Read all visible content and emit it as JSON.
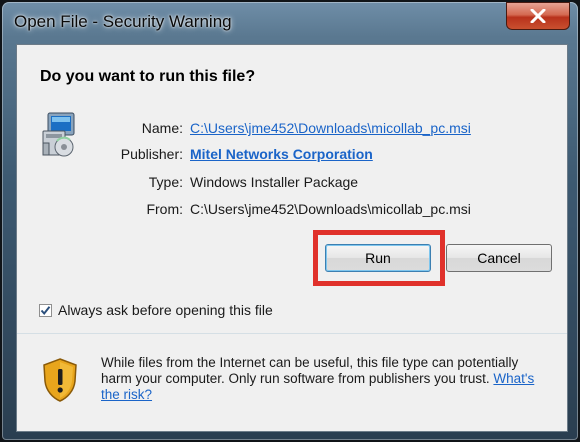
{
  "window": {
    "title": "Open File - Security Warning",
    "close_glyph": "✕"
  },
  "dialog": {
    "question": "Do you want to run this file?",
    "fields": [
      {
        "label": "Name:",
        "value": "C:\\Users\\jme452\\Downloads\\micollab_pc.msi",
        "style": "link"
      },
      {
        "label": "Publisher:",
        "value": "Mitel Networks Corporation",
        "style": "link-bold"
      },
      {
        "label": "Type:",
        "value": "Windows Installer Package",
        "style": "text"
      },
      {
        "label": "From:",
        "value": "C:\\Users\\jme452\\Downloads\\micollab_pc.msi",
        "style": "text"
      }
    ],
    "run_label": "Run",
    "cancel_label": "Cancel",
    "checkbox": {
      "label": "Always ask before opening this file",
      "checked": true
    },
    "warning": {
      "text": "While files from the Internet can be useful, this file type can potentially harm your computer. Only run software from publishers you trust.",
      "link": "What's the risk?"
    }
  },
  "colors": {
    "accent_link": "#1a64c8",
    "highlight": "#e0312b"
  },
  "icons": [
    "installer-package-icon",
    "security-shield-icon",
    "close-icon",
    "checkmark-icon"
  ]
}
